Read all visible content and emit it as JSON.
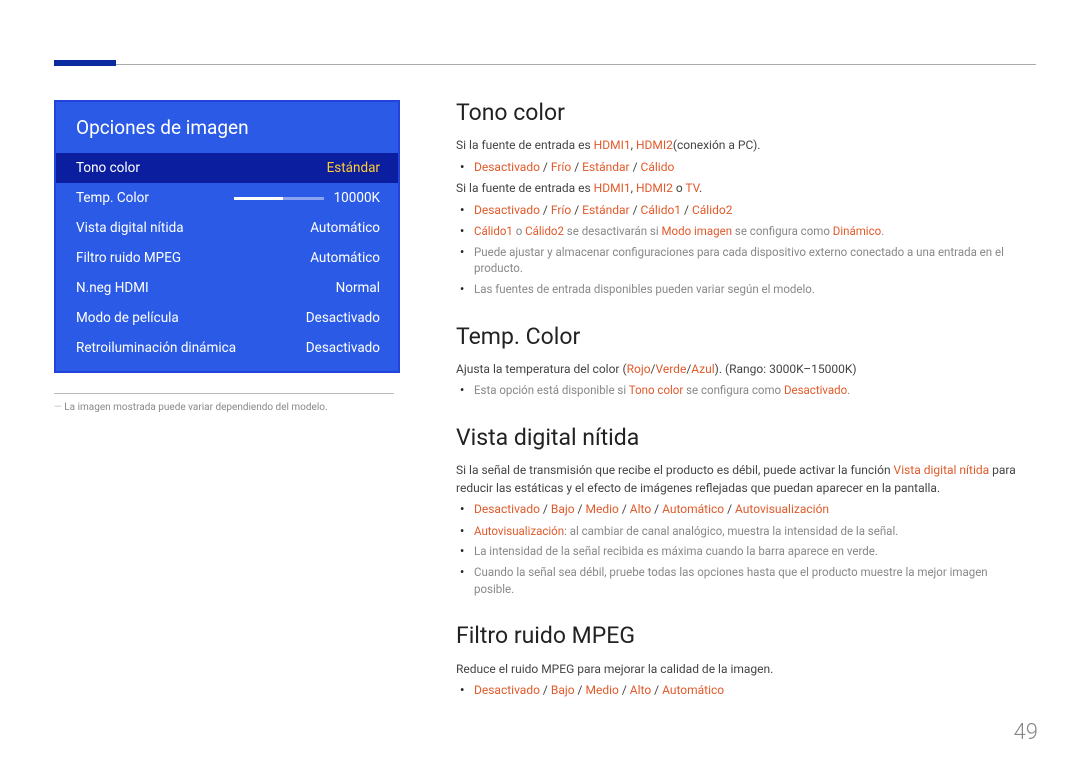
{
  "page_number": "49",
  "panel": {
    "title": "Opciones de imagen",
    "rows": [
      {
        "label": "Tono color",
        "value": "Estándar",
        "selected": true,
        "slider": false
      },
      {
        "label": "Temp. Color",
        "value": "10000K",
        "selected": false,
        "slider": true
      },
      {
        "label": "Vista digital nítida",
        "value": "Automático",
        "selected": false,
        "slider": false
      },
      {
        "label": "Filtro ruido MPEG",
        "value": "Automático",
        "selected": false,
        "slider": false
      },
      {
        "label": "N.neg HDMI",
        "value": "Normal",
        "selected": false,
        "slider": false
      },
      {
        "label": "Modo de película",
        "value": "Desactivado",
        "selected": false,
        "slider": false
      },
      {
        "label": "Retroiluminación dinámica",
        "value": "Desactivado",
        "selected": false,
        "slider": false
      }
    ],
    "caption": "La imagen mostrada puede variar dependiendo del modelo."
  },
  "sec1": {
    "h": "Tono color",
    "p1a": "Si la fuente de entrada es ",
    "p1b": "HDMI1",
    "p1c": ", ",
    "p1d": "HDMI2",
    "p1e": "(conexión a PC).",
    "opt1": {
      "a": "Desactivado",
      "b": "Frío",
      "c": "Estándar",
      "d": "Cálido"
    },
    "p2a": "Si la fuente de entrada es ",
    "p2b": "HDMI1",
    "p2c": ", ",
    "p2d": "HDMI2",
    "p2e": " o ",
    "p2f": "TV",
    "p2g": ".",
    "opt2": {
      "a": "Desactivado",
      "b": "Frío",
      "c": "Estándar",
      "d": "Cálido1",
      "e": "Cálido2"
    },
    "d1a": "Cálido1",
    "d1b": " o ",
    "d1c": "Cálido2",
    "d1d": " se desactivarán si ",
    "d1e": "Modo imagen",
    "d1f": " se configura como ",
    "d1g": "Dinámico",
    "d1h": ".",
    "d2": "Puede ajustar y almacenar configuraciones para cada dispositivo externo conectado a una entrada en el producto.",
    "d3": "Las fuentes de entrada disponibles pueden variar según el modelo."
  },
  "sec2": {
    "h": "Temp. Color",
    "p1a": "Ajusta la temperatura del color (",
    "p1r": "Rojo",
    "p1s1": "/",
    "p1g": "Verde",
    "p1s2": "/",
    "p1b": "Azul",
    "p1c": "). (Rango: 3000K–15000K)",
    "d1a": "Esta opción está disponible si ",
    "d1b": "Tono color",
    "d1c": " se configura como ",
    "d1d": "Desactivado",
    "d1e": "."
  },
  "sec3": {
    "h": "Vista digital nítida",
    "p1a": "Si la señal de transmisión que recibe el producto es débil, puede activar la función ",
    "p1b": "Vista digital nítida",
    "p1c": " para reducir las estáticas y el efecto de imágenes reflejadas que puedan aparecer en la pantalla.",
    "opt": {
      "a": "Desactivado",
      "b": "Bajo",
      "c": "Medio",
      "d": "Alto",
      "e": "Automático",
      "f": "Autovisualización"
    },
    "d1a": "Autovisualización",
    "d1b": ": al cambiar de canal analógico, muestra la intensidad de la señal.",
    "d2": "La intensidad de la señal recibida es máxima cuando la barra aparece en verde.",
    "d3": "Cuando la señal sea débil, pruebe todas las opciones hasta que el producto muestre la mejor imagen posible."
  },
  "sec4": {
    "h": "Filtro ruido MPEG",
    "p1": "Reduce el ruido MPEG para mejorar la calidad de la imagen.",
    "opt": {
      "a": "Desactivado",
      "b": "Bajo",
      "c": "Medio",
      "d": "Alto",
      "e": "Automático"
    }
  },
  "sep": " / "
}
